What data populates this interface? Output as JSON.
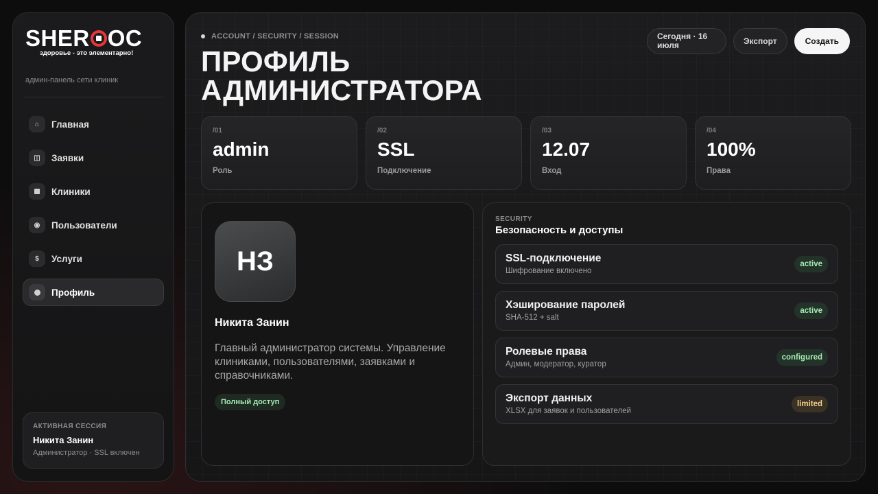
{
  "brand": {
    "logo_left": "SHER",
    "logo_right": "OC",
    "tagline": "здоровье - это элементарно!",
    "accent_color": "#e8363a"
  },
  "sidebar": {
    "subtitle": "админ-панель сети клиник",
    "items": [
      {
        "label": "Главная",
        "icon": "home-icon"
      },
      {
        "label": "Заявки",
        "icon": "requests-icon"
      },
      {
        "label": "Клиники",
        "icon": "clinic-icon"
      },
      {
        "label": "Пользователи",
        "icon": "users-icon"
      },
      {
        "label": "Услуги",
        "icon": "dollar-icon"
      },
      {
        "label": "Профиль",
        "icon": "profile-icon",
        "active": true
      }
    ],
    "session": {
      "caption": "АКТИВНАЯ СЕССИЯ",
      "name": "Никита Занин",
      "role": "Администратор · SSL включен"
    }
  },
  "header": {
    "breadcrumb": "ACCOUNT / SECURITY / SESSION",
    "title": "ПРОФИЛЬ АДМИНИСТРАТОРА",
    "date": "Сегодня · 16 июля",
    "export_label": "Экспорт",
    "create_label": "Создать"
  },
  "stats": [
    {
      "index": "/01",
      "value": "admin",
      "label": "Роль"
    },
    {
      "index": "/02",
      "value": "SSL",
      "label": "Подключение"
    },
    {
      "index": "/03",
      "value": "12.07",
      "label": "Вход"
    },
    {
      "index": "/04",
      "value": "100%",
      "label": "Права"
    }
  ],
  "profile": {
    "initials": "НЗ",
    "name": "Никита Занин",
    "description": "Главный администратор системы. Управление клиниками, пользователями, заявками и справочниками.",
    "access_badge": "Полный доступ"
  },
  "security": {
    "caption": "SECURITY",
    "title": "Безопасность и доступы",
    "items": [
      {
        "name": "SSL-подключение",
        "desc": "Шифрование включено",
        "status": "active",
        "tone": "ok"
      },
      {
        "name": "Хэширование паролей",
        "desc": "SHA-512 + salt",
        "status": "active",
        "tone": "ok"
      },
      {
        "name": "Ролевые права",
        "desc": "Админ, модератор, куратор",
        "status": "configured",
        "tone": "ok"
      },
      {
        "name": "Экспорт данных",
        "desc": "XLSX для заявок и пользователей",
        "status": "limited",
        "tone": "warn"
      }
    ]
  }
}
